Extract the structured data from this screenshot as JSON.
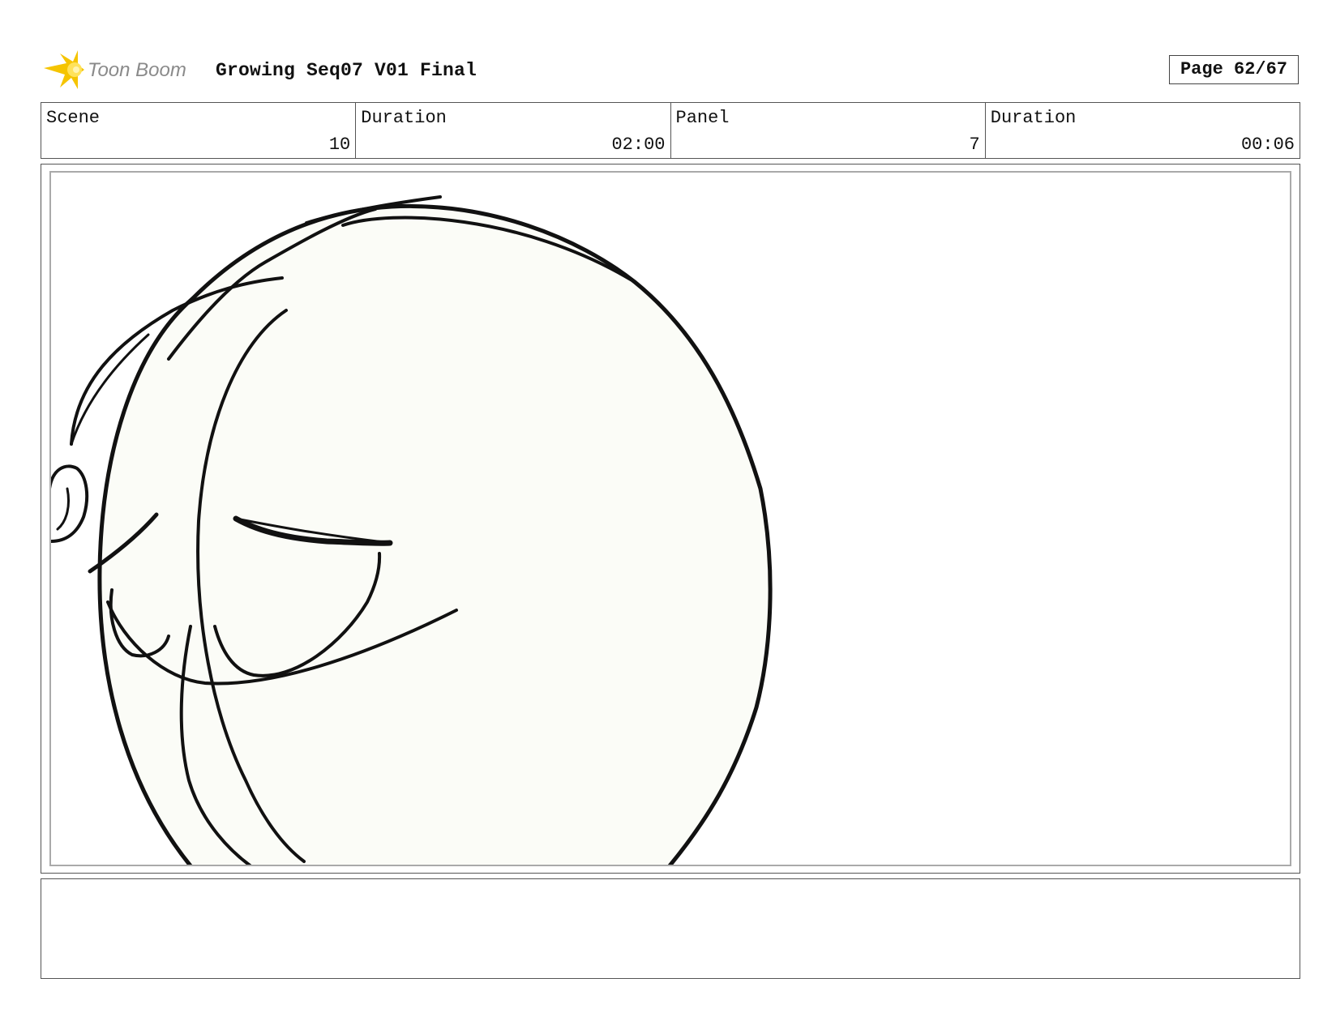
{
  "header": {
    "brand": "Toon Boom",
    "title": "Growing Seq07 V01 Final",
    "page": "Page 62/67"
  },
  "info": [
    {
      "label": "Scene",
      "value": "10"
    },
    {
      "label": "Duration",
      "value": "02:00"
    },
    {
      "label": "Panel",
      "value": "7"
    },
    {
      "label": "Duration",
      "value": "00:06"
    }
  ],
  "caption": "",
  "colors": {
    "logo_yellow": "#f5c400",
    "logo_text": "#8a8a8a",
    "face_fill": "#fbfcf7",
    "ink": "#111111"
  }
}
